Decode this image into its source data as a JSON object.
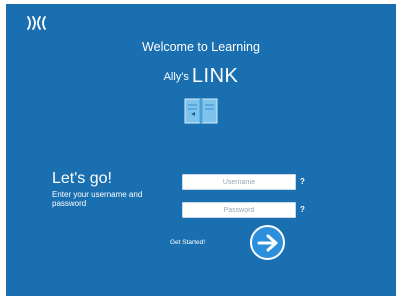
{
  "header": {
    "welcome_text": "Welcome to Learning",
    "brand_small": "Ally's",
    "brand_large": "LINK"
  },
  "login": {
    "heading": "Let's go!",
    "instructions": "Enter your username and password",
    "username_placeholder": "Username",
    "password_placeholder": "Password",
    "help_label": "?",
    "get_started_label": "Get Started!"
  },
  "icons": {
    "logo": "sound-waves-icon",
    "book": "open-book-icon",
    "submit": "arrow-right-icon"
  },
  "colors": {
    "background": "#1a6fb0",
    "button": "#2b8fdc",
    "text": "#ffffff"
  }
}
